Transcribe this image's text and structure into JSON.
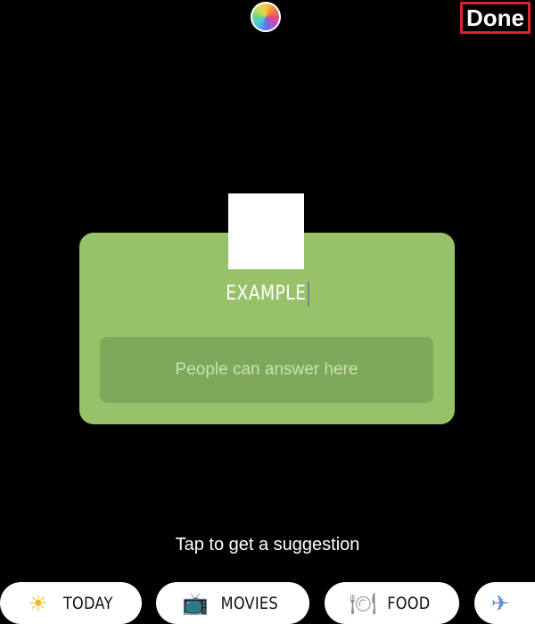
{
  "toolbar": {
    "color_picker_icon": "color-wheel-icon",
    "done_label": "Done",
    "done_highlight_color": "#e0202a"
  },
  "sticker": {
    "background_color": "#97c26a",
    "title": "EXAMPLE",
    "answer_placeholder": "People can answer here"
  },
  "suggestion": {
    "prompt": "Tap to get a suggestion",
    "chips": [
      {
        "icon": "sun-icon",
        "glyph": "☀",
        "label": "TODAY"
      },
      {
        "icon": "tv-icon",
        "glyph": "📺",
        "label": "MOVIES"
      },
      {
        "icon": "plate-icon",
        "glyph": "🍽",
        "label": "FOOD"
      },
      {
        "icon": "airplane-icon",
        "glyph": "✈",
        "label": ""
      }
    ]
  }
}
